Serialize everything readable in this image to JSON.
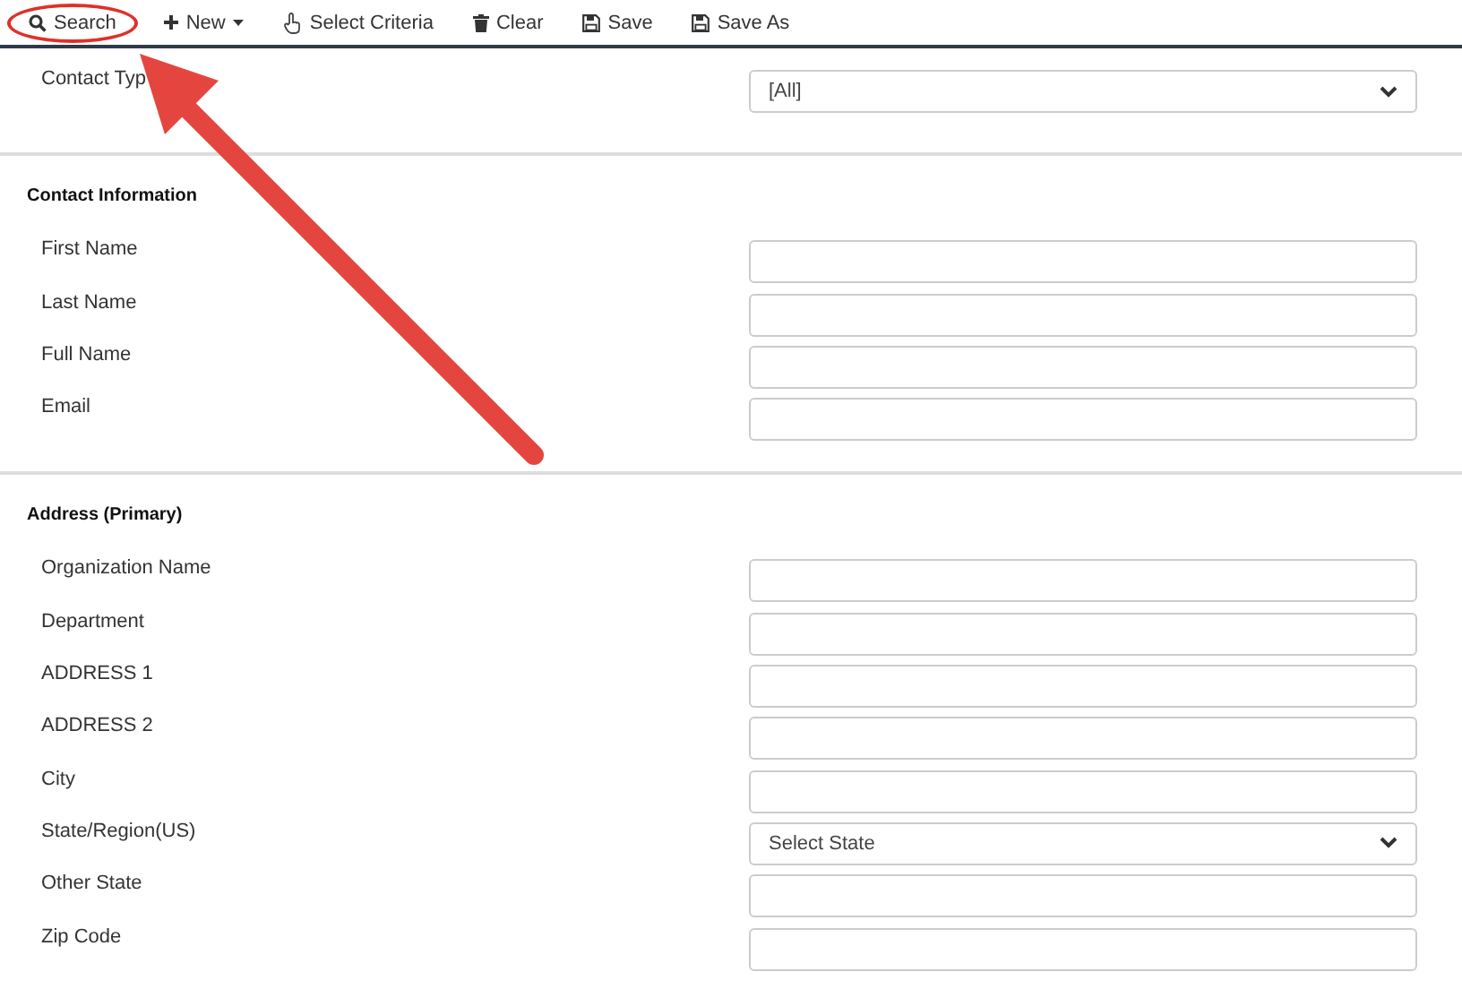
{
  "toolbar": [
    {
      "label": "Search",
      "kind": "search",
      "has_menu": false,
      "highlighted": true
    },
    {
      "label": "New",
      "kind": "plus",
      "has_menu": true,
      "highlighted": false
    },
    {
      "label": "Select Criteria",
      "kind": "hand",
      "has_menu": false,
      "highlighted": false
    },
    {
      "label": "Clear",
      "kind": "trash",
      "has_menu": false,
      "highlighted": false
    },
    {
      "label": "Save",
      "kind": "disk",
      "has_menu": false,
      "highlighted": false
    },
    {
      "label": "Save As",
      "kind": "disk",
      "has_menu": false,
      "highlighted": false
    }
  ],
  "sections": [
    {
      "fields": [
        {
          "label": "Contact Typ",
          "kind": "select",
          "value": "[All]"
        }
      ]
    },
    {
      "heading": "Contact Information",
      "fields": [
        {
          "label": "First Name",
          "kind": "text"
        },
        {
          "label": "Last Name",
          "kind": "text"
        },
        {
          "label": "Full Name",
          "kind": "text"
        },
        {
          "label": "Email",
          "kind": "text"
        }
      ]
    },
    {
      "heading": "Address (Primary)",
      "fields": [
        {
          "label": "Organization Name",
          "kind": "text"
        },
        {
          "label": "Department",
          "kind": "text"
        },
        {
          "label": "ADDRESS 1",
          "kind": "text"
        },
        {
          "label": "ADDRESS 2",
          "kind": "text"
        },
        {
          "label": "City",
          "kind": "text"
        },
        {
          "label": "State/Region(US)",
          "kind": "select",
          "value": "Select State"
        },
        {
          "label": "Other State",
          "kind": "text"
        },
        {
          "label": "Zip Code",
          "kind": "text"
        }
      ]
    }
  ]
}
